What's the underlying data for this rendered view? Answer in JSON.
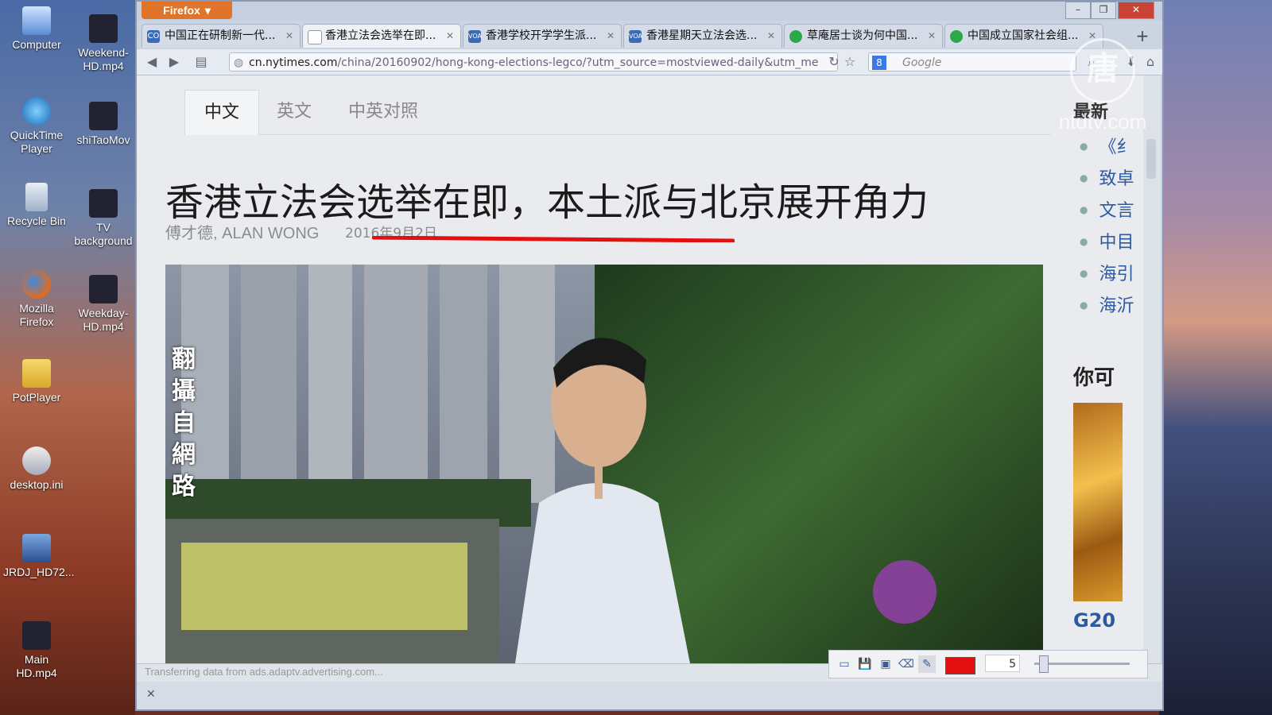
{
  "desktop": {
    "icons": [
      {
        "label": "Computer",
        "icon": "computer-icon"
      },
      {
        "label": "Weekend-HD.mp4",
        "icon": "video-file-icon"
      },
      {
        "label": "QuickTime Player",
        "icon": "quicktime-icon"
      },
      {
        "label": "shiTaoMov",
        "icon": "video-file-icon"
      },
      {
        "label": "Recycle Bin",
        "icon": "recycle-bin-icon"
      },
      {
        "label": "TV background",
        "icon": "video-file-icon"
      },
      {
        "label": "Mozilla Firefox",
        "icon": "firefox-icon"
      },
      {
        "label": "Weekday-HD.mp4",
        "icon": "video-file-icon"
      },
      {
        "label": "PotPlayer",
        "icon": "folder-icon"
      },
      {
        "label": "desktop.ini",
        "icon": "settings-file-icon"
      },
      {
        "label": "JRDJ_HD72...",
        "icon": "video-file-icon"
      },
      {
        "label": "Main HD.mp4",
        "icon": "video-file-icon"
      }
    ]
  },
  "browser": {
    "menu_label": "Firefox",
    "tabs": [
      {
        "label": "中国正在研制新一代...",
        "favicon": "CO"
      },
      {
        "label": "香港立法会选举在即...",
        "favicon": ""
      },
      {
        "label": "香港学校开学学生派...",
        "favicon": "VOA"
      },
      {
        "label": "香港星期天立法会选...",
        "favicon": "VOA"
      },
      {
        "label": "草庵居士谈为何中国...",
        "favicon": ""
      },
      {
        "label": "中国成立国家社会组...",
        "favicon": ""
      }
    ],
    "url_domain": "cn.nytimes.com",
    "url_path": "/china/20160902/hong-kong-elections-legco/?utm_source=mostviewed-daily&utm_me",
    "search_placeholder": "Google",
    "status_text": "Transferring data from ads.adaptv.advertising.com..."
  },
  "article": {
    "lang_tabs": [
      "中文",
      "英文",
      "中英对照"
    ],
    "headline": "香港立法会选举在即，本土派与北京展开角力",
    "byline": "傅才德, ALAN WONG",
    "date": "2016年9月2日",
    "photo_caption_vertical": "翻攝自網路"
  },
  "sidebar": {
    "title": "最新",
    "items": [
      "《纟",
      "致卓",
      "文言",
      "中目",
      "海引",
      "海沂"
    ],
    "section_title": "你可",
    "bottom_link": "G20"
  },
  "annotation_toolbar": {
    "pen_size": "5",
    "color": "#e21010"
  },
  "watermark": {
    "logo_char": "唐",
    "text": "ntdtv.com"
  },
  "colors": {
    "firefox_orange": "#e0742a",
    "link_blue": "#2c5aa0",
    "annotation_red": "#e21010"
  }
}
